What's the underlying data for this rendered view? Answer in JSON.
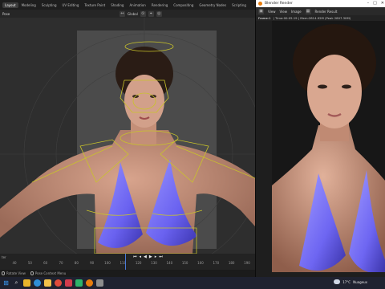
{
  "workspace_tabs": [
    "Layout",
    "Modeling",
    "Sculpting",
    "UV Editing",
    "Texture Paint",
    "Shading",
    "Animation",
    "Rendering",
    "Compositing",
    "Geometry Nodes",
    "Scripting"
  ],
  "viewport": {
    "mode_label": "Pose",
    "orientation_label": "Global",
    "pivot_icon": "pivot-icon",
    "snap_icon": "snap-icon",
    "proportional_icon": "proportional-icon"
  },
  "timeline": {
    "left_label": "ter",
    "ticks": [
      "40",
      "50",
      "60",
      "70",
      "80",
      "90",
      "100",
      "110",
      "120",
      "130",
      "140",
      "150",
      "160",
      "170",
      "180",
      "190"
    ],
    "playback_icons": [
      "jump-start-icon",
      "step-back-icon",
      "play-reverse-icon",
      "play-icon",
      "step-forward-icon",
      "jump-end-icon"
    ]
  },
  "statusbar": {
    "item1": "Rotate View",
    "item2": "Pose Context Menu"
  },
  "render_window": {
    "title": "Blender Render",
    "menu": [
      "View",
      "View",
      "Image"
    ],
    "slot_label": "Render Result",
    "info_frame": "Frame:1",
    "info_stats": "| Time:00:05.19 | Mem:2814.92M (Peak 2807.30M)"
  },
  "taskbar": {
    "apps": [
      "start-icon",
      "search-icon",
      "file-explorer-icon",
      "edge-icon",
      "explorer-folder-icon",
      "chrome-icon",
      "app-icon",
      "media-icon",
      "blender-icon",
      "store-icon"
    ],
    "weather_temp": "17°C",
    "weather_desc": "Nuageux"
  },
  "colors": {
    "accent": "#4a7ad8",
    "bikini": "#7a72ff",
    "armature": "#c9c42a",
    "blender_orange": "#e87d0d"
  }
}
